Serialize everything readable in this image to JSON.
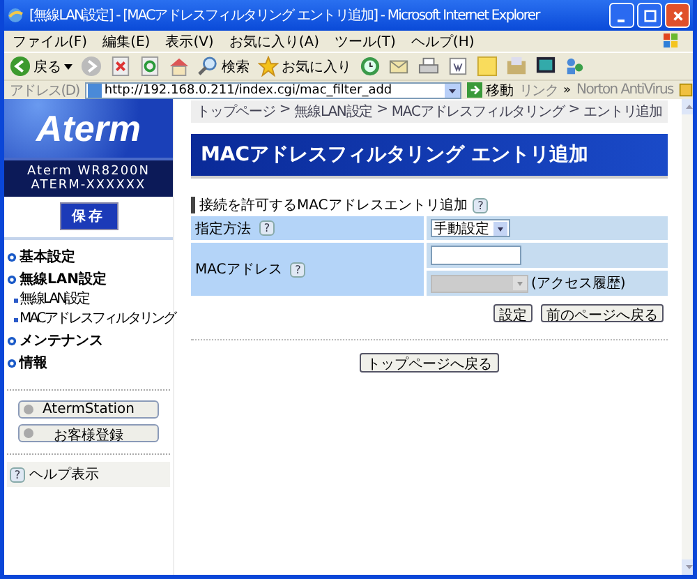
{
  "window": {
    "title": "[無線LAN設定] - [MACアドレスフィルタリング エントリ追加] - Microsoft Internet Explorer"
  },
  "menu": [
    "ファイル(F)",
    "編集(E)",
    "表示(V)",
    "お気に入り(A)",
    "ツール(T)",
    "ヘルプ(H)"
  ],
  "toolbar": {
    "back": "戻る",
    "search": "検索",
    "favorites": "お気に入り"
  },
  "address_bar": {
    "label": "アドレス(D)",
    "url": "http://192.168.0.211/index.cgi/mac_filter_add",
    "go": "移動",
    "links": "リンク",
    "more": "»",
    "norton": "Norton AntiVirus"
  },
  "sidebar": {
    "logo": "Aterm",
    "model": "Aterm WR8200N",
    "device": "ATERM-XXXXXX",
    "save": "保存",
    "nav": [
      {
        "label": "基本設定"
      },
      {
        "label": "無線LAN設定",
        "children": [
          {
            "label": "無線LAN設定"
          },
          {
            "label": "MACアドレスフィルタリング"
          }
        ]
      },
      {
        "label": "メンテナンス"
      },
      {
        "label": "情報"
      }
    ],
    "buttons": [
      "AtermStation",
      "お客様登録"
    ],
    "help": {
      "icon": "?",
      "label": "ヘルプ表示"
    }
  },
  "main": {
    "breadcrumb": [
      "トップページ",
      "無線LAN設定",
      "MACアドレスフィルタリング",
      "エントリ追加"
    ],
    "separator": ">",
    "heading": "MACアドレスフィルタリング エントリ追加",
    "section": {
      "title": "接続を許可するMACアドレスエントリ追加",
      "help": "?"
    },
    "rows": [
      {
        "label": "指定方法",
        "help": "?",
        "kind": "select",
        "value": "手動設定"
      },
      {
        "label": "MACアドレス",
        "help": "?",
        "kind": "mac",
        "history_label": "(アクセス履歴)",
        "history_disabled": true
      }
    ],
    "buttons": [
      "設定",
      "前のページへ戻る"
    ],
    "top_button": "トップページへ戻る"
  }
}
